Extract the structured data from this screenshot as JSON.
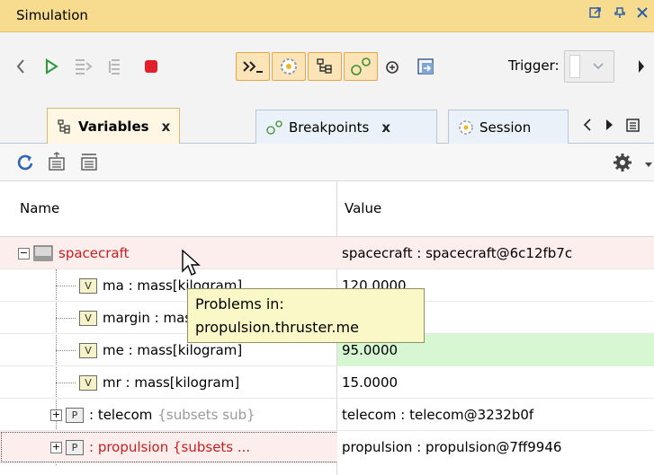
{
  "window": {
    "title": "Simulation",
    "controls": [
      "pin-icon",
      "dock-icon",
      "close-icon"
    ]
  },
  "toolbar": {
    "trigger_label": "Trigger:",
    "trigger_value": ""
  },
  "tabs": [
    {
      "label": "Variables",
      "close": "x",
      "active": true
    },
    {
      "label": "Breakpoints",
      "close": "x",
      "active": false
    },
    {
      "label": "Session",
      "active": false
    }
  ],
  "table": {
    "headers": {
      "name": "Name",
      "value": "Value"
    },
    "rows": [
      {
        "name": "spacecraft",
        "value": "spacecraft : spacecraft@6c12fb7c"
      },
      {
        "name": "ma : mass[kilogram]",
        "value": "120.0000"
      },
      {
        "name": "margin : mass[kilogram]",
        "value": ""
      },
      {
        "name": "me : mass[kilogram]",
        "value": "95.0000"
      },
      {
        "name": "mr : mass[kilogram]",
        "value": "15.0000"
      },
      {
        "name": " : telecom",
        "extra": "{subsets sub}",
        "value": "telecom : telecom@3232b0f"
      },
      {
        "name": " : propulsion {subsets ...",
        "value": "propulsion : propulsion@7ff9946"
      }
    ]
  },
  "tooltip": {
    "line1": "Problems in:",
    "line2": "propulsion.thruster.me"
  },
  "colors": {
    "titlebar": "#f7dc8f",
    "error_text": "#c81e1e",
    "changed_value_bg": "#d6f7d1",
    "tooltip_bg": "#fbf8c8"
  }
}
